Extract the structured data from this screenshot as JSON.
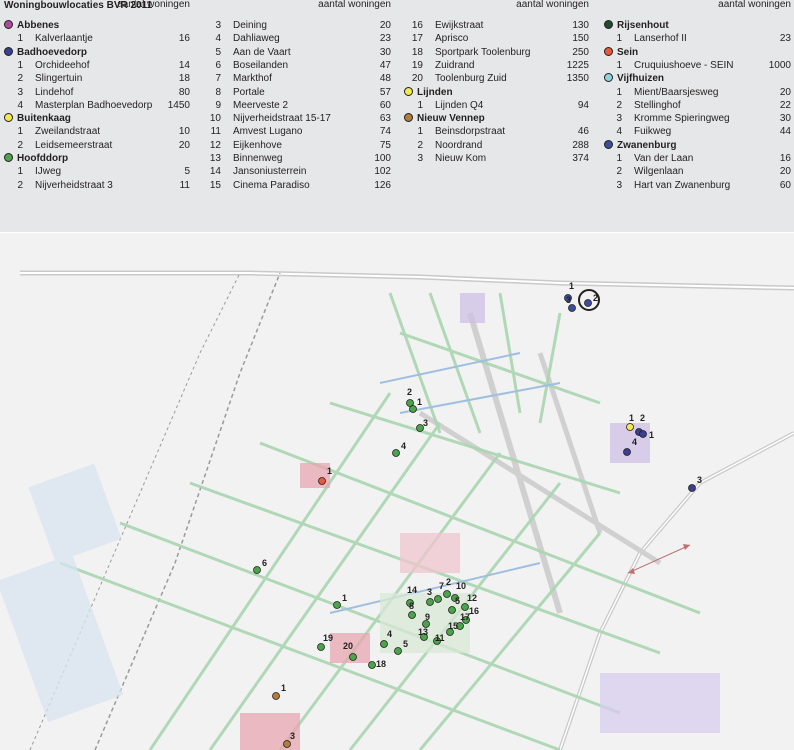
{
  "title": "Woningbouwlocaties BVR 2011",
  "col_header": "aantal woningen",
  "colors": {
    "Abbenes": "#b04a9c",
    "Badhoevedorp": "#3a3f8f",
    "Buitenkaag": "#f2e94e",
    "Hoofddorp": "#4aa54a",
    "Lijnden": "#f2e94e",
    "Nieuw Vennep": "#b07d3a",
    "Rijsenhout": "#1f4b2f",
    "Sein": "#e8593c",
    "Vijfhuizen": "#8fd3de",
    "Zwanenburg": "#3a4f9a",
    "panel": "#e6e7e8"
  },
  "columns": [
    {
      "rows": [
        {
          "type": "group",
          "name": "Abbenes",
          "color": "#b04a9c"
        },
        {
          "type": "item",
          "num": "1",
          "name": "Kalverlaantje",
          "count": "16"
        },
        {
          "type": "group",
          "name": "Badhoevedorp",
          "color": "#3a3f8f"
        },
        {
          "type": "item",
          "num": "1",
          "name": "Orchideehof",
          "count": "14"
        },
        {
          "type": "item",
          "num": "2",
          "name": "Slingertuin",
          "count": "18"
        },
        {
          "type": "item",
          "num": "3",
          "name": "Lindehof",
          "count": "80"
        },
        {
          "type": "item",
          "num": "4",
          "name": "Masterplan Badhoevedorp",
          "count": "1450"
        },
        {
          "type": "group",
          "name": "Buitenkaag",
          "color": "#f2e94e"
        },
        {
          "type": "item",
          "num": "1",
          "name": "Zweilandstraat",
          "count": "10"
        },
        {
          "type": "item",
          "num": "2",
          "name": "Leidsemeerstraat",
          "count": "20"
        },
        {
          "type": "group",
          "name": "Hoofddorp",
          "color": "#4aa54a"
        },
        {
          "type": "item",
          "num": "1",
          "name": "IJweg",
          "count": "5"
        },
        {
          "type": "item",
          "num": "2",
          "name": "Nijverheidstraat 3",
          "count": "11"
        }
      ]
    },
    {
      "rows": [
        {
          "type": "item",
          "num": "3",
          "name": "Deining",
          "count": "20"
        },
        {
          "type": "item",
          "num": "4",
          "name": "Dahliaweg",
          "count": "23"
        },
        {
          "type": "item",
          "num": "5",
          "name": "Aan de Vaart",
          "count": "30"
        },
        {
          "type": "item",
          "num": "6",
          "name": "Boseilanden",
          "count": "47"
        },
        {
          "type": "item",
          "num": "7",
          "name": "Markthof",
          "count": "48"
        },
        {
          "type": "item",
          "num": "8",
          "name": "Portale",
          "count": "57"
        },
        {
          "type": "item",
          "num": "9",
          "name": "Meerveste 2",
          "count": "60"
        },
        {
          "type": "item",
          "num": "10",
          "name": "Nijverheidstraat 15-17",
          "count": "63"
        },
        {
          "type": "item",
          "num": "11",
          "name": "Amvest Lugano",
          "count": "74"
        },
        {
          "type": "item",
          "num": "12",
          "name": "Eijkenhove",
          "count": "75"
        },
        {
          "type": "item",
          "num": "13",
          "name": "Binnenweg",
          "count": "100"
        },
        {
          "type": "item",
          "num": "14",
          "name": "Jansoniusterrein",
          "count": "102"
        },
        {
          "type": "item",
          "num": "15",
          "name": "Cinema Paradiso",
          "count": "126"
        }
      ]
    },
    {
      "rows": [
        {
          "type": "item",
          "num": "16",
          "name": "Ewijkstraat",
          "count": "130"
        },
        {
          "type": "item",
          "num": "17",
          "name": "Aprisco",
          "count": "150"
        },
        {
          "type": "item",
          "num": "18",
          "name": "Sportpark Toolenburg",
          "count": "250"
        },
        {
          "type": "item",
          "num": "19",
          "name": "Zuidrand",
          "count": "1225"
        },
        {
          "type": "item",
          "num": "20",
          "name": "Toolenburg Zuid",
          "count": "1350"
        },
        {
          "type": "group",
          "name": "Lijnden",
          "color": "#f2e94e"
        },
        {
          "type": "item",
          "num": "1",
          "name": "Lijnden Q4",
          "count": "94"
        },
        {
          "type": "group",
          "name": "Nieuw Vennep",
          "color": "#b07d3a"
        },
        {
          "type": "item",
          "num": "1",
          "name": "Beinsdorpstraat",
          "count": "46"
        },
        {
          "type": "item",
          "num": "2",
          "name": "Noordrand",
          "count": "288"
        },
        {
          "type": "item",
          "num": "3",
          "name": "Nieuw Kom",
          "count": "374"
        }
      ]
    },
    {
      "rows": [
        {
          "type": "group",
          "name": "Rijsenhout",
          "color": "#1f4b2f"
        },
        {
          "type": "item",
          "num": "1",
          "name": "Lanserhof II",
          "count": "23"
        },
        {
          "type": "group",
          "name": "Sein",
          "color": "#e8593c"
        },
        {
          "type": "item",
          "num": "1",
          "name": "Cruquiushoeve - SEIN",
          "count": "1000"
        },
        {
          "type": "group",
          "name": "Vijfhuizen",
          "color": "#8fd3de"
        },
        {
          "type": "item",
          "num": "1",
          "name": "Mient/Baarsjesweg",
          "count": "20"
        },
        {
          "type": "item",
          "num": "2",
          "name": "Stellinghof",
          "count": "22"
        },
        {
          "type": "item",
          "num": "3",
          "name": "Kromme Spieringweg",
          "count": "30"
        },
        {
          "type": "item",
          "num": "4",
          "name": "Fuikweg",
          "count": "44"
        },
        {
          "type": "group",
          "name": "Zwanenburg",
          "color": "#3a4f9a"
        },
        {
          "type": "item",
          "num": "1",
          "name": "Van der Laan",
          "count": "16"
        },
        {
          "type": "item",
          "num": "2",
          "name": "Wilgenlaan",
          "count": "20"
        },
        {
          "type": "item",
          "num": "3",
          "name": "Hart van Zwanenburg",
          "count": "60"
        }
      ]
    }
  ],
  "map_markers": [
    {
      "label": "1",
      "color": "#3a4f9a"
    },
    {
      "label": "3",
      "color": "#3a4f9a"
    },
    {
      "label": "2",
      "color": "#3a4f9a"
    },
    {
      "label": "2",
      "color": "#4aa54a"
    },
    {
      "label": "1",
      "color": "#4aa54a"
    },
    {
      "label": "3",
      "color": "#4aa54a"
    },
    {
      "label": "4",
      "color": "#4aa54a"
    },
    {
      "label": "1",
      "color": "#e8593c"
    },
    {
      "label": "1",
      "color": "#f2e94e"
    },
    {
      "label": "2",
      "color": "#3a3f8f"
    },
    {
      "label": "1",
      "color": "#3a3f8f"
    },
    {
      "label": "4",
      "color": "#3a3f8f"
    },
    {
      "label": "3",
      "color": "#3a3f8f"
    },
    {
      "label": "6",
      "color": "#4aa54a"
    },
    {
      "label": "1",
      "color": "#4aa54a"
    },
    {
      "label": "14",
      "color": "#4aa54a"
    },
    {
      "label": "3",
      "color": "#4aa54a"
    },
    {
      "label": "7",
      "color": "#4aa54a"
    },
    {
      "label": "2",
      "color": "#4aa54a"
    },
    {
      "label": "10",
      "color": "#4aa54a"
    },
    {
      "label": "12",
      "color": "#4aa54a"
    },
    {
      "label": "8",
      "color": "#4aa54a"
    },
    {
      "label": "5",
      "color": "#4aa54a"
    },
    {
      "label": "16",
      "color": "#4aa54a"
    },
    {
      "label": "9",
      "color": "#4aa54a"
    },
    {
      "label": "17",
      "color": "#4aa54a"
    },
    {
      "label": "15",
      "color": "#4aa54a"
    },
    {
      "label": "13",
      "color": "#4aa54a"
    },
    {
      "label": "11",
      "color": "#4aa54a"
    },
    {
      "label": "19",
      "color": "#4aa54a"
    },
    {
      "label": "4",
      "color": "#4aa54a"
    },
    {
      "label": "5",
      "color": "#4aa54a"
    },
    {
      "label": "20",
      "color": "#4aa54a"
    },
    {
      "label": "18",
      "color": "#4aa54a"
    },
    {
      "label": "1",
      "color": "#b07d3a"
    },
    {
      "label": "3",
      "color": "#b07d3a"
    }
  ]
}
